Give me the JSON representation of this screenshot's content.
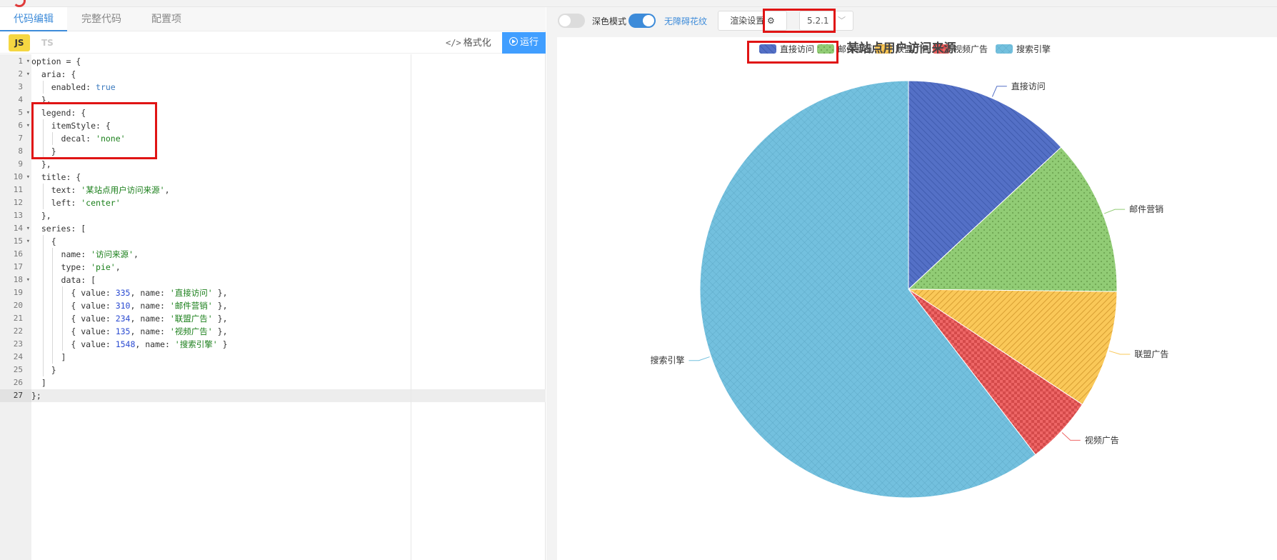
{
  "tabs": [
    {
      "label": "代码编辑"
    },
    {
      "label": "完整代码"
    },
    {
      "label": "配置项"
    }
  ],
  "toolbar": {
    "js_label": "JS",
    "ts_label": "TS",
    "format_icon": "</>",
    "format_label": "格式化",
    "run_label": "运行"
  },
  "code": {
    "lines": [
      "option = {",
      "  aria: {",
      "    enabled: true",
      "  },",
      "  legend: {",
      "    itemStyle: {",
      "      decal: 'none'",
      "    }",
      "  },",
      "  title: {",
      "    text: '某站点用户访问来源',",
      "    left: 'center'",
      "  },",
      "  series: [",
      "    {",
      "      name: '访问来源',",
      "      type: 'pie',",
      "      data: [",
      "        { value: 335, name: '直接访问' },",
      "        { value: 310, name: '邮件营销' },",
      "        { value: 234, name: '联盟广告' },",
      "        { value: 135, name: '视频广告' },",
      "        { value: 1548, name: '搜索引擎' }",
      "      ]",
      "    }",
      "  ]",
      "};"
    ]
  },
  "preview": {
    "dark_mode_label": "深色模式",
    "aria_label": "无障碍花纹",
    "render_settings_label": "渲染设置",
    "version": "5.2.1"
  },
  "chart_data": {
    "type": "pie",
    "title": "某站点用户访问来源",
    "legend": [
      "直接访问",
      "邮件营销",
      "联盟广告",
      "视频广告",
      "搜索引擎"
    ],
    "legend_placement": "top-center",
    "series": [
      {
        "name": "访问来源",
        "data": [
          {
            "name": "直接访问",
            "value": 335
          },
          {
            "name": "邮件营销",
            "value": 310
          },
          {
            "name": "联盟广告",
            "value": 234
          },
          {
            "name": "视频广告",
            "value": 135
          },
          {
            "name": "搜索引擎",
            "value": 1548
          }
        ]
      }
    ],
    "colors": [
      "#5470c6",
      "#91cc75",
      "#fac858",
      "#ee6666",
      "#73c0de"
    ]
  }
}
